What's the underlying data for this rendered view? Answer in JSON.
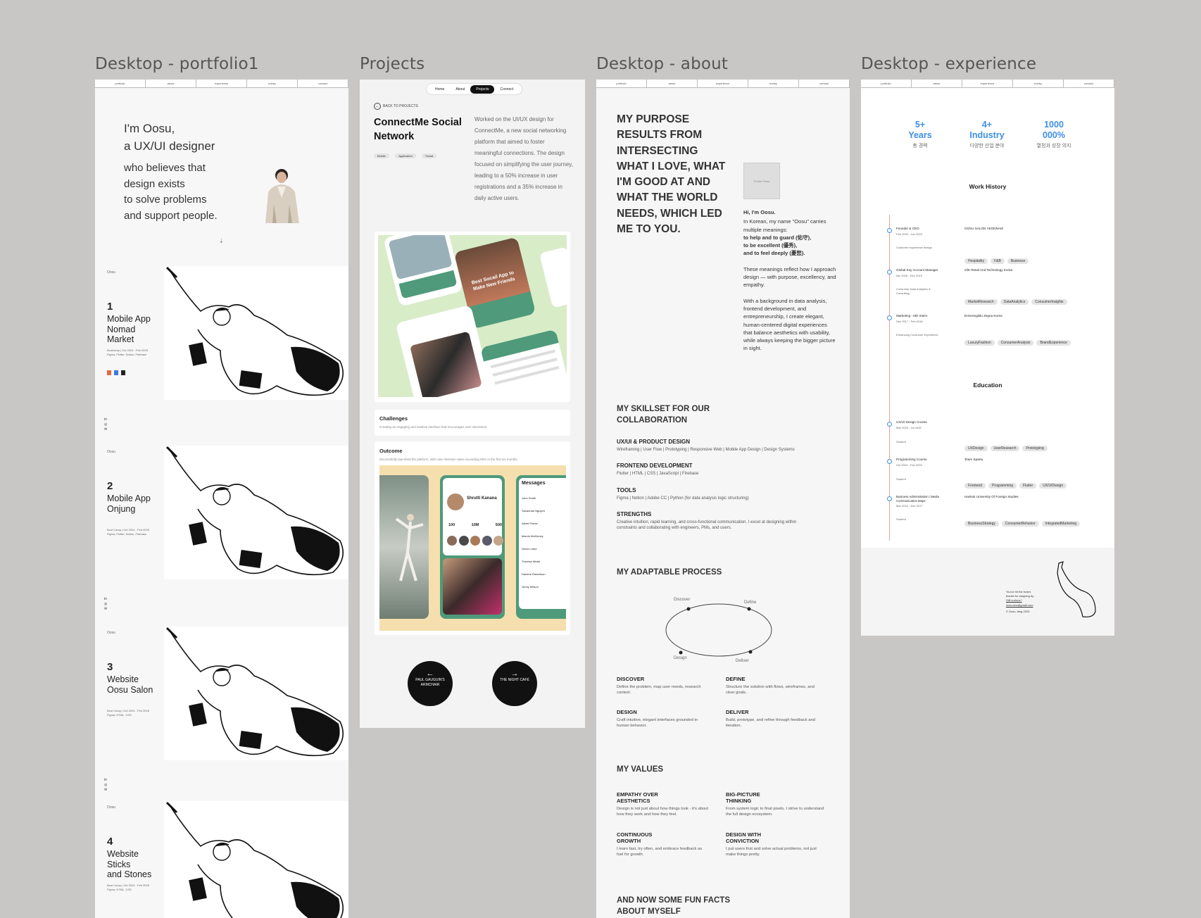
{
  "frames": {
    "portfolio": "Desktop - portfolio1",
    "projects": "Projects",
    "about": "Desktop - about",
    "experience": "Desktop - experience"
  },
  "nav_small": [
    "portfolio",
    "about",
    "experience",
    "hobby",
    "contact"
  ],
  "portfolio": {
    "intro_line1": "I'm Oosu,",
    "intro_line2": "a UX/UI designer",
    "tagline": [
      "who believes that",
      "design exists",
      "to solve problems",
      "and support people."
    ],
    "projects": [
      {
        "num": "1",
        "title": [
          "Mobile App",
          "Nomad",
          "Market"
        ],
        "meta1": "Bootcamp | Oct 2024 - Feb 2025",
        "meta2": "Figma, Flutter, Notion, Firebase",
        "corner": "Oosu"
      },
      {
        "num": "2",
        "title": [
          "Mobile App",
          "Onjung"
        ],
        "meta1": "Boot Camp | Oct 2024 - Feb 2025",
        "meta2": "Figma, Flutter, Notion, Firebase",
        "corner": "Oosu"
      },
      {
        "num": "3",
        "title": [
          "Website",
          "Oosu Salon"
        ],
        "meta1": "Boot Camp | Oct 2024 - Feb 2025",
        "meta2": "Figma, HTML, CSS",
        "corner": "Oosu"
      },
      {
        "num": "4",
        "title": [
          "Website",
          "Sticks",
          "and Stones"
        ],
        "meta1": "Boot Camp | Oct 2024 - Feb 2025",
        "meta2": "Figma, HTML, CSS",
        "corner": "Oosu"
      }
    ]
  },
  "project_page": {
    "nav": [
      "Home",
      "About",
      "Projects",
      "Connect"
    ],
    "active_nav": "Projects",
    "back": "BACK TO PROJECTS",
    "title": "ConnectMe Social Network",
    "tags": [
      "Mobile",
      "Application",
      "Social"
    ],
    "description": "Worked on the UI/UX design for ConnectMe, a new social networking platform that aimed to foster meaningful connections. The design focused on simplifying the user journey, leading to a 50% increase in user registrations and a 35% increase in daily active users.",
    "hero_banner": "Best Socail App to Make New Friends",
    "challenges_title": "Challenges",
    "challenges_text": "Creating an engaging and intuitive interface that encourages user interaction",
    "outcome_title": "Outcome",
    "outcome_text": "Successfully launched the platform, with user retention rates exceeding 80% in the first six months",
    "profile_name": "Shrutti Kanana",
    "profile_stats": [
      "100",
      "10M",
      "500"
    ],
    "messages_title": "Messages",
    "messages": [
      "John Smith",
      "Savannah Nguyen",
      "Albert Flores",
      "Marvin McKinney",
      "Devon Lane",
      "Theresa Webb",
      "Darlene Robertson",
      "Jenny Wilson"
    ],
    "prev_label": "PAUL GAUGUIN'S ARMCHAIR",
    "next_label": "THE NIGHT CAFÉ"
  },
  "about": {
    "headline": "MY PURPOSE RESULTS FROM INTERSECTING WHAT I LOVE, WHAT I'M GOOD AT AND WHAT THE WORLD NEEDS, WHICH LED ME TO YOU.",
    "photo_label": "Profile Photo",
    "hi": "Hi, I'm Oosu.",
    "meaning_intro": "In Korean, my name \"Oosu\" carries multiple meanings:",
    "meanings": [
      "to help and to guard (佑守),",
      "to be excellent (優秀),",
      "and to feel deeply (憂愁)."
    ],
    "reflect": "These meanings reflect how I approach design — with purpose, excellency, and empathy.",
    "background": "With a background in data analysis, frontend development, and entrepreneurship, I create elegant, human-centered digital experiences that balance aesthetics with usability, while always keeping the bigger picture in sight.",
    "skillset_title": "MY SKILLSET FOR OUR COLLABORATION",
    "skills": [
      {
        "h": "UX/UI & PRODUCT DESIGN",
        "t": "Wireframing | User Flow | Prototyping | Responsive Web | Mobile App Design | Design Systems"
      },
      {
        "h": "FRONTEND DEVELOPMENT",
        "t": "Flutter | HTML | CSS | JavaScript | Firebase"
      },
      {
        "h": "TOOLS",
        "t": "Figma | Notion | Adobe CC | Python (for data analysis logic structuring)"
      },
      {
        "h": "STRENGTHS",
        "t": "Creative intuition, rapid learning, and cross-functional communication. I excel at designing within constraints and collaborating with engineers, PMs, and users."
      }
    ],
    "process_title": "MY ADAPTABLE PROCESS",
    "process_nodes": [
      "Discover",
      "Define",
      "Design",
      "Deliver"
    ],
    "process_steps": [
      {
        "h": "DISCOVER",
        "t": "Define the problem, map user needs, research context."
      },
      {
        "h": "DEFINE",
        "t": "Structure the solution with flows, wireframes, and clear goals."
      },
      {
        "h": "DESIGN",
        "t": "Craft intuitive, elegant interfaces grounded in human behavior."
      },
      {
        "h": "DELIVER",
        "t": "Build, prototype, and refine through feedback and iteration."
      }
    ],
    "values_title": "MY VALUES",
    "values": [
      {
        "h": "EMPATHY OVER AESTHETICS",
        "t": "Design is not just about how things look - it's about how they work and how they feel."
      },
      {
        "h": "BIG-PICTURE THINKING",
        "t": "From system logic to final pixels, I strive to understand the full design ecosystem."
      },
      {
        "h": "CONTINUOUS GROWTH",
        "t": "I learn fast, try often, and embrace feedback as fuel for growth."
      },
      {
        "h": "DESIGN WITH CONVICTION",
        "t": "I put users first and solve actual problems, not just make things pretty."
      }
    ],
    "fun_title": "AND NOW SOME FUN FACTS ABOUT MYSELF"
  },
  "experience": {
    "stats": [
      {
        "big": "5+",
        "big2": "Years",
        "sub": "총 경력"
      },
      {
        "big": "4+",
        "big2": "Industry",
        "sub": "다양한 산업 분야"
      },
      {
        "big": "1000",
        "big2": "000%",
        "sub": "열정과 성장 의지"
      }
    ],
    "work_title": "Work History",
    "work": [
      {
        "role": "Founder & CEO",
        "date": "Feb 2020 - Jun 2024",
        "desc": "Customer experience design",
        "org": "OOSU SALON YEONNAM",
        "tags": [
          "Hospitality",
          "F&B",
          "Business"
        ]
      },
      {
        "role": "Global Key Account Manager",
        "date": "Apr 2018 - Dec 2019",
        "desc": "Consumer Data Analytics & Consulting",
        "org": "GfK Retail And Technology Korea",
        "tags": [
          "MarketResearch",
          "DataAnalytics",
          "ConsumerInsights"
        ]
      },
      {
        "role": "Marketing - MD Intern",
        "date": "Dec 2017 - Feb 2018",
        "desc": "Enhancing Consumer Experience",
        "org": "Ermenegildo Zegna Korea",
        "tags": [
          "LuxuryFashion",
          "ConsumerAnalysis",
          "BrandExperience"
        ]
      }
    ],
    "edu_title": "Education",
    "edu": [
      {
        "role": "UX/UI Design Course",
        "date": "Mar 2025 - Jul 2025",
        "desc": "Student",
        "org": "",
        "tags": [
          "UXDesign",
          "UserResearch",
          "Prototyping"
        ]
      },
      {
        "role": "Programming Course",
        "date": "Oct 2024 - Feb 2025",
        "desc": "Student",
        "org": "Team Sparta",
        "tags": [
          "Frontend",
          "Programming",
          "Flutter",
          "UX/UIDesign"
        ]
      },
      {
        "role": "Business Administration / Media Communication Major",
        "date": "Mar 2010 - Dec 2017",
        "desc": "Student",
        "org": "Hankuk University Of Foreign Studies",
        "tags": [
          "BusinessStrategy",
          "ConsumerBehavior",
          "IntegratedMarketing"
        ]
      }
    ],
    "footer_thanks": "You've hit the footer, thanks for stopping by.",
    "footer_cta": "Still curious?",
    "footer_email": "oosu.seo@gmail.com",
    "footer_copy": "© Oosu Jang 2025"
  },
  "colors": {
    "accent_blue": "#3d8ee6",
    "timeline_red": "#e8a0a0",
    "pill": "#e4e4e4",
    "app_green": "#4e9a7a",
    "app_bg": "#d8ecc8",
    "outcome_bg": "#f6dfae"
  }
}
